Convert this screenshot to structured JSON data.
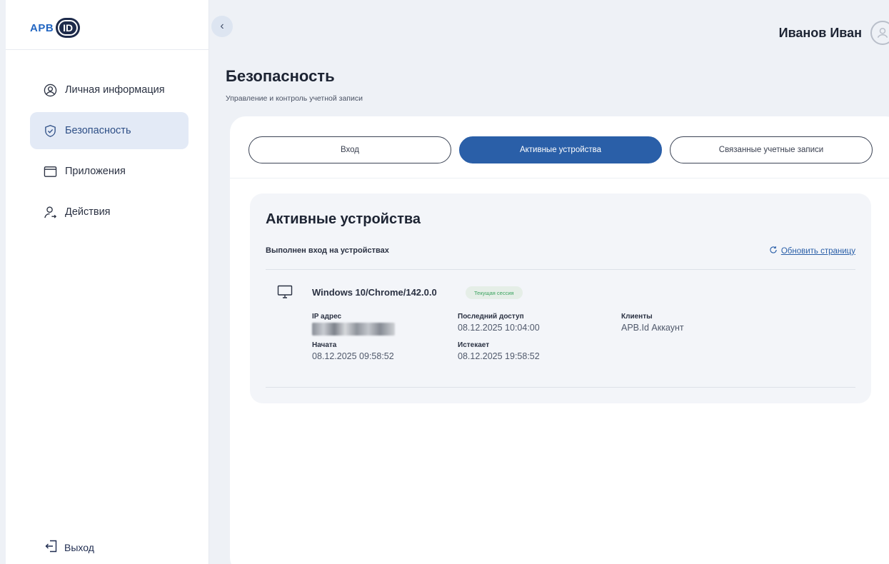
{
  "logo": {
    "text": "АРВ",
    "badge": "ID"
  },
  "sidebar": {
    "items": [
      {
        "label": "Личная информация",
        "icon": "user-circle-icon",
        "active": false
      },
      {
        "label": "Безопасность",
        "icon": "shield-check-icon",
        "active": true
      },
      {
        "label": "Приложения",
        "icon": "window-icon",
        "active": false
      },
      {
        "label": "Действия",
        "icon": "user-activity-icon",
        "active": false
      }
    ],
    "logout_label": "Выход"
  },
  "header": {
    "user_name": "Иванов Иван"
  },
  "page": {
    "title": "Безопасность",
    "subtitle": "Управление и контроль учетной записи"
  },
  "tabs": [
    {
      "label": "Вход",
      "active": false
    },
    {
      "label": "Активные устройства",
      "active": true
    },
    {
      "label": "Связанные учетные записи",
      "active": false
    }
  ],
  "devices": {
    "title": "Активные устройства",
    "subtitle": "Выполнен вход на устройствах",
    "refresh_label": "Обновить страницу",
    "items": [
      {
        "name": "Windows 10/Chrome/142.0.0",
        "badge": "Текущая сессия",
        "ip_label": "IP адрес",
        "last_access_label": "Последний доступ",
        "last_access": "08.12.2025 10:04:00",
        "clients_label": "Клиенты",
        "clients": "APB.Id Аккаунт",
        "started_label": "Начата",
        "started": "08.12.2025 09:58:52",
        "expires_label": "Истекает",
        "expires": "08.12.2025 19:58:52"
      }
    ]
  },
  "colors": {
    "accent": "#2a5fa8",
    "active_nav_bg": "#e3eaf6",
    "badge_green": "#3aa35f",
    "page_bg": "#eef1f6"
  }
}
